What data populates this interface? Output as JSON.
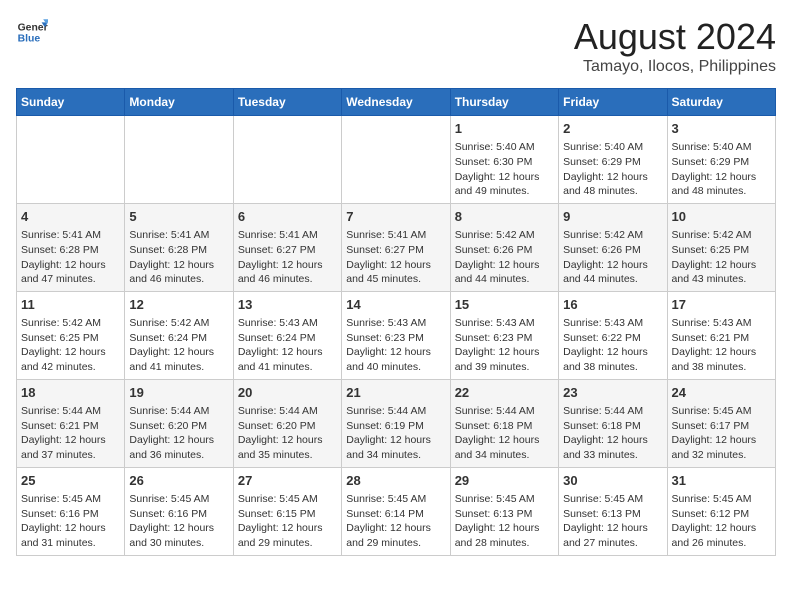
{
  "header": {
    "logo_line1": "General",
    "logo_line2": "Blue",
    "title": "August 2024",
    "subtitle": "Tamayo, Ilocos, Philippines"
  },
  "days_of_week": [
    "Sunday",
    "Monday",
    "Tuesday",
    "Wednesday",
    "Thursday",
    "Friday",
    "Saturday"
  ],
  "weeks": [
    [
      {
        "day": "",
        "content": ""
      },
      {
        "day": "",
        "content": ""
      },
      {
        "day": "",
        "content": ""
      },
      {
        "day": "",
        "content": ""
      },
      {
        "day": "1",
        "content": "Sunrise: 5:40 AM\nSunset: 6:30 PM\nDaylight: 12 hours\nand 49 minutes."
      },
      {
        "day": "2",
        "content": "Sunrise: 5:40 AM\nSunset: 6:29 PM\nDaylight: 12 hours\nand 48 minutes."
      },
      {
        "day": "3",
        "content": "Sunrise: 5:40 AM\nSunset: 6:29 PM\nDaylight: 12 hours\nand 48 minutes."
      }
    ],
    [
      {
        "day": "4",
        "content": "Sunrise: 5:41 AM\nSunset: 6:28 PM\nDaylight: 12 hours\nand 47 minutes."
      },
      {
        "day": "5",
        "content": "Sunrise: 5:41 AM\nSunset: 6:28 PM\nDaylight: 12 hours\nand 46 minutes."
      },
      {
        "day": "6",
        "content": "Sunrise: 5:41 AM\nSunset: 6:27 PM\nDaylight: 12 hours\nand 46 minutes."
      },
      {
        "day": "7",
        "content": "Sunrise: 5:41 AM\nSunset: 6:27 PM\nDaylight: 12 hours\nand 45 minutes."
      },
      {
        "day": "8",
        "content": "Sunrise: 5:42 AM\nSunset: 6:26 PM\nDaylight: 12 hours\nand 44 minutes."
      },
      {
        "day": "9",
        "content": "Sunrise: 5:42 AM\nSunset: 6:26 PM\nDaylight: 12 hours\nand 44 minutes."
      },
      {
        "day": "10",
        "content": "Sunrise: 5:42 AM\nSunset: 6:25 PM\nDaylight: 12 hours\nand 43 minutes."
      }
    ],
    [
      {
        "day": "11",
        "content": "Sunrise: 5:42 AM\nSunset: 6:25 PM\nDaylight: 12 hours\nand 42 minutes."
      },
      {
        "day": "12",
        "content": "Sunrise: 5:42 AM\nSunset: 6:24 PM\nDaylight: 12 hours\nand 41 minutes."
      },
      {
        "day": "13",
        "content": "Sunrise: 5:43 AM\nSunset: 6:24 PM\nDaylight: 12 hours\nand 41 minutes."
      },
      {
        "day": "14",
        "content": "Sunrise: 5:43 AM\nSunset: 6:23 PM\nDaylight: 12 hours\nand 40 minutes."
      },
      {
        "day": "15",
        "content": "Sunrise: 5:43 AM\nSunset: 6:23 PM\nDaylight: 12 hours\nand 39 minutes."
      },
      {
        "day": "16",
        "content": "Sunrise: 5:43 AM\nSunset: 6:22 PM\nDaylight: 12 hours\nand 38 minutes."
      },
      {
        "day": "17",
        "content": "Sunrise: 5:43 AM\nSunset: 6:21 PM\nDaylight: 12 hours\nand 38 minutes."
      }
    ],
    [
      {
        "day": "18",
        "content": "Sunrise: 5:44 AM\nSunset: 6:21 PM\nDaylight: 12 hours\nand 37 minutes."
      },
      {
        "day": "19",
        "content": "Sunrise: 5:44 AM\nSunset: 6:20 PM\nDaylight: 12 hours\nand 36 minutes."
      },
      {
        "day": "20",
        "content": "Sunrise: 5:44 AM\nSunset: 6:20 PM\nDaylight: 12 hours\nand 35 minutes."
      },
      {
        "day": "21",
        "content": "Sunrise: 5:44 AM\nSunset: 6:19 PM\nDaylight: 12 hours\nand 34 minutes."
      },
      {
        "day": "22",
        "content": "Sunrise: 5:44 AM\nSunset: 6:18 PM\nDaylight: 12 hours\nand 34 minutes."
      },
      {
        "day": "23",
        "content": "Sunrise: 5:44 AM\nSunset: 6:18 PM\nDaylight: 12 hours\nand 33 minutes."
      },
      {
        "day": "24",
        "content": "Sunrise: 5:45 AM\nSunset: 6:17 PM\nDaylight: 12 hours\nand 32 minutes."
      }
    ],
    [
      {
        "day": "25",
        "content": "Sunrise: 5:45 AM\nSunset: 6:16 PM\nDaylight: 12 hours\nand 31 minutes."
      },
      {
        "day": "26",
        "content": "Sunrise: 5:45 AM\nSunset: 6:16 PM\nDaylight: 12 hours\nand 30 minutes."
      },
      {
        "day": "27",
        "content": "Sunrise: 5:45 AM\nSunset: 6:15 PM\nDaylight: 12 hours\nand 29 minutes."
      },
      {
        "day": "28",
        "content": "Sunrise: 5:45 AM\nSunset: 6:14 PM\nDaylight: 12 hours\nand 29 minutes."
      },
      {
        "day": "29",
        "content": "Sunrise: 5:45 AM\nSunset: 6:13 PM\nDaylight: 12 hours\nand 28 minutes."
      },
      {
        "day": "30",
        "content": "Sunrise: 5:45 AM\nSunset: 6:13 PM\nDaylight: 12 hours\nand 27 minutes."
      },
      {
        "day": "31",
        "content": "Sunrise: 5:45 AM\nSunset: 6:12 PM\nDaylight: 12 hours\nand 26 minutes."
      }
    ]
  ]
}
